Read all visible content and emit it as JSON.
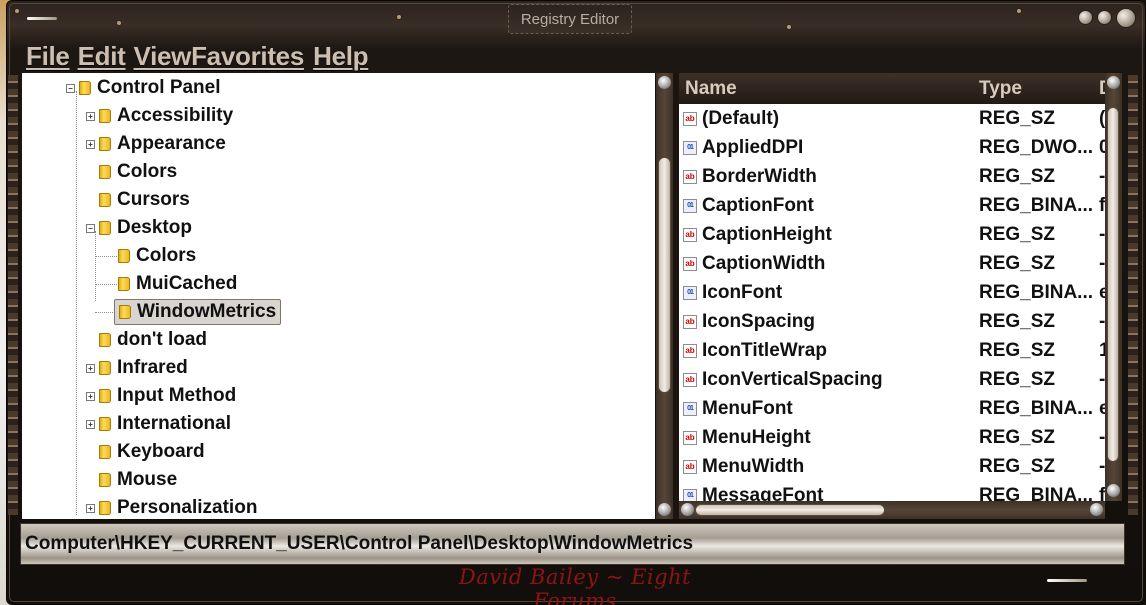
{
  "window": {
    "title": "Registry Editor"
  },
  "menu": {
    "items": [
      "File",
      "Edit",
      "View",
      "Favorites",
      "Help"
    ]
  },
  "tree": {
    "items": [
      {
        "label": "Control Panel",
        "expander": "−"
      },
      {
        "label": "Accessibility",
        "expander": "+"
      },
      {
        "label": "Appearance",
        "expander": "+"
      },
      {
        "label": "Colors",
        "expander": ""
      },
      {
        "label": "Cursors",
        "expander": ""
      },
      {
        "label": "Desktop",
        "expander": "−"
      },
      {
        "label": "Colors",
        "expander": ""
      },
      {
        "label": "MuiCached",
        "expander": ""
      },
      {
        "label": "WindowMetrics",
        "expander": "",
        "selected": true
      },
      {
        "label": "don't load",
        "expander": ""
      },
      {
        "label": "Infrared",
        "expander": "+"
      },
      {
        "label": "Input Method",
        "expander": "+"
      },
      {
        "label": "International",
        "expander": "+"
      },
      {
        "label": "Keyboard",
        "expander": ""
      },
      {
        "label": "Mouse",
        "expander": ""
      },
      {
        "label": "Personalization",
        "expander": "+"
      }
    ]
  },
  "list": {
    "headers": {
      "name": "Name",
      "type": "Type",
      "data": "D"
    },
    "rows": [
      {
        "icon": "ab",
        "name": "(Default)",
        "type": "REG_SZ",
        "data": "("
      },
      {
        "icon": "bin",
        "name": "AppliedDPI",
        "type": "REG_DWO...",
        "data": "0"
      },
      {
        "icon": "ab",
        "name": "BorderWidth",
        "type": "REG_SZ",
        "data": "-"
      },
      {
        "icon": "bin",
        "name": "CaptionFont",
        "type": "REG_BINA...",
        "data": "f"
      },
      {
        "icon": "ab",
        "name": "CaptionHeight",
        "type": "REG_SZ",
        "data": "-"
      },
      {
        "icon": "ab",
        "name": "CaptionWidth",
        "type": "REG_SZ",
        "data": "-"
      },
      {
        "icon": "bin",
        "name": "IconFont",
        "type": "REG_BINA...",
        "data": "e"
      },
      {
        "icon": "ab",
        "name": "IconSpacing",
        "type": "REG_SZ",
        "data": "-"
      },
      {
        "icon": "ab",
        "name": "IconTitleWrap",
        "type": "REG_SZ",
        "data": "1"
      },
      {
        "icon": "ab",
        "name": "IconVerticalSpacing",
        "type": "REG_SZ",
        "data": "-"
      },
      {
        "icon": "bin",
        "name": "MenuFont",
        "type": "REG_BINA...",
        "data": "e"
      },
      {
        "icon": "ab",
        "name": "MenuHeight",
        "type": "REG_SZ",
        "data": "-"
      },
      {
        "icon": "ab",
        "name": "MenuWidth",
        "type": "REG_SZ",
        "data": "-"
      },
      {
        "icon": "bin",
        "name": "MessageFont",
        "type": "REG_BINA...",
        "data": "f"
      }
    ]
  },
  "status": {
    "path": "Computer\\HKEY_CURRENT_USER\\Control Panel\\Desktop\\WindowMetrics"
  },
  "signature": "David Bailey ~ Eight Forums",
  "colors": {
    "frame": "#1d1713",
    "accent": "#cdbfb0",
    "signature": "#8e1414"
  }
}
